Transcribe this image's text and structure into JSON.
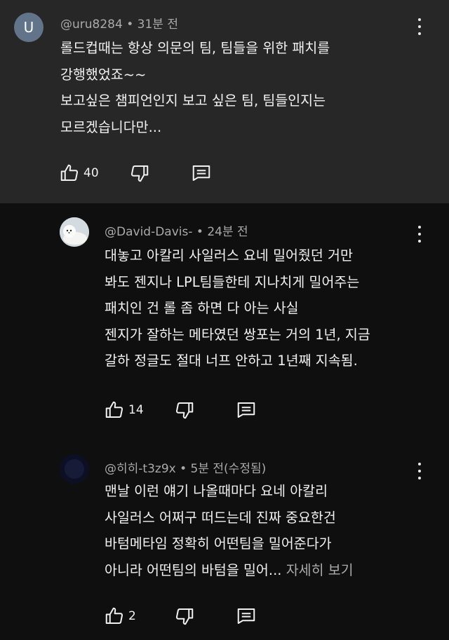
{
  "comments": [
    {
      "avatar_letter": "U",
      "author": "@uru8284",
      "time": "31분 전",
      "lines": [
        "롤드컵때는 항상 의문의 팀, 팀들을 위한 패치를",
        "강행했었죠~~",
        "보고싶은 챔피언인지 보고 싶은 팀, 팀들인지는",
        "모르겠습니다만..."
      ],
      "likes": "40"
    },
    {
      "author": "@David-Davis-",
      "time": "24분 전",
      "lines": [
        "대놓고 아칼리 사일러스 요네 밀어줬던 거만",
        "봐도 젠지나 LPL팀들한테 지나치게 밀어주는",
        "패치인 건 롤 좀 하면 다 아는 사실",
        "젠지가 잘하는 메타였던 쌍포는 거의 1년, 지금",
        "갈하 정글도 절대 너프 안하고 1년째 지속됨."
      ],
      "likes": "14"
    },
    {
      "author": "@히히-t3z9x",
      "time": "5분 전(수정됨)",
      "lines": [
        "맨날 이런 얘기 나올때마다 요네 아칼리",
        "사일러스 어쩌구 떠드는데 진짜 중요한건",
        "바텀메타임 정확히 어떤팀을 밀어준다가",
        "아니라 어떤팀의 바텀을 밀어..."
      ],
      "more_label": "자세히 보기",
      "likes": "2"
    }
  ],
  "separator": " • ",
  "colors": {
    "bg": "#0f0f0f",
    "highlight_bg": "#272727",
    "text": "#f1f1f1",
    "meta": "#aaaaaa"
  },
  "icons": {
    "like": "thumbs-up-icon",
    "dislike": "thumbs-down-icon",
    "reply": "reply-comment-icon",
    "menu": "kebab-menu-icon"
  }
}
